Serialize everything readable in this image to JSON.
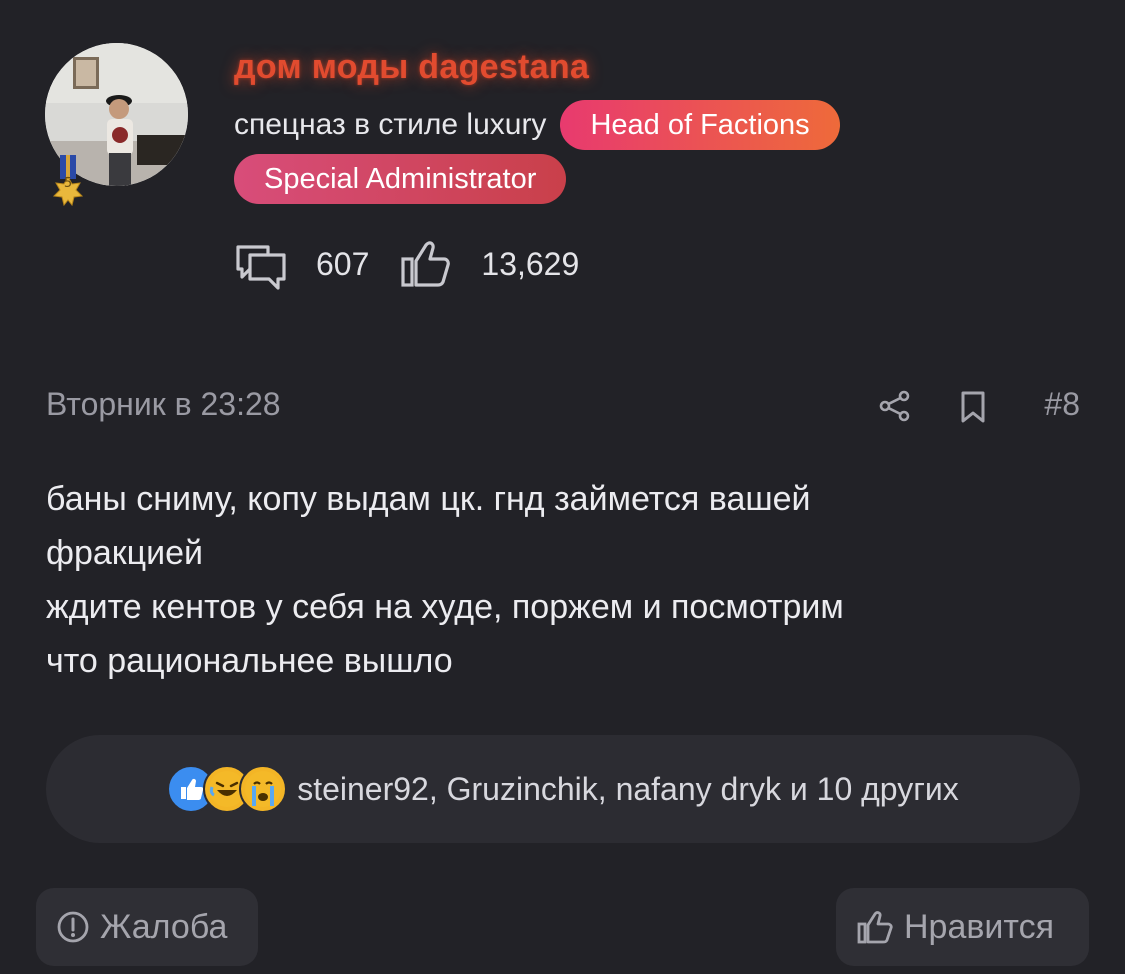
{
  "user": {
    "name": "дом моды dagestana",
    "status": "спецназ в стиле luxury",
    "badges": [
      "Head of Factions",
      "Special Administrator"
    ],
    "medal_level": "5",
    "stats": {
      "messages": "607",
      "likes": "13,629"
    }
  },
  "post": {
    "date": "Вторник в 23:28",
    "number": "#8",
    "lines": [
      "баны сниму, копу выдам цк. гнд займется вашей",
      "фракцией",
      "ждите кентов у себя на худе, поржем и посмотрим",
      "что рациональнее вышло"
    ]
  },
  "reactions": {
    "icons": [
      "like-reaction",
      "laugh-reaction",
      "cry-reaction"
    ],
    "text": "steiner92, Gruzinchik, nafany dryk и 10 других"
  },
  "actions": {
    "report_label": "Жалоба",
    "like_label": "Нравится"
  },
  "colors": {
    "background": "#222227",
    "username": "#e14b2f",
    "badge_hof": "#e83a6f",
    "badge_sa": "#d84d7a"
  }
}
